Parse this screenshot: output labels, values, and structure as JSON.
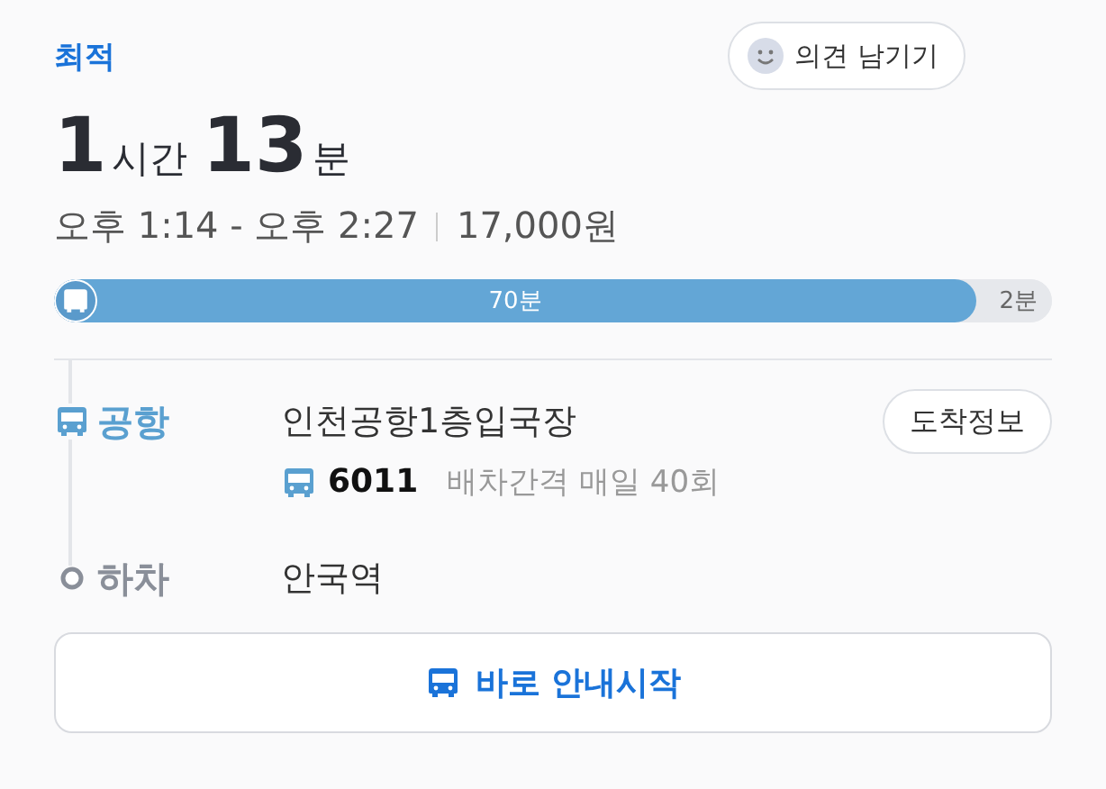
{
  "badge": "최적",
  "feedback_button": "의견 남기기",
  "duration": {
    "hours": "1",
    "hours_unit": "시간",
    "minutes": "13",
    "minutes_unit": "분"
  },
  "time_range": "오후 1:14 - 오후 2:27",
  "fare": "17,000원",
  "segments": [
    {
      "kind": "bus",
      "label": "70분"
    },
    {
      "kind": "walk",
      "label": "2분"
    }
  ],
  "steps": [
    {
      "kind": "board",
      "label": "공항",
      "place": "인천공항1층입국장",
      "button": "도착정보",
      "bus": {
        "number": "6011",
        "interval": "배차간격 매일 40회"
      }
    },
    {
      "kind": "alight",
      "label": "하차",
      "place": "안국역"
    }
  ],
  "start_button": "바로 안내시작"
}
